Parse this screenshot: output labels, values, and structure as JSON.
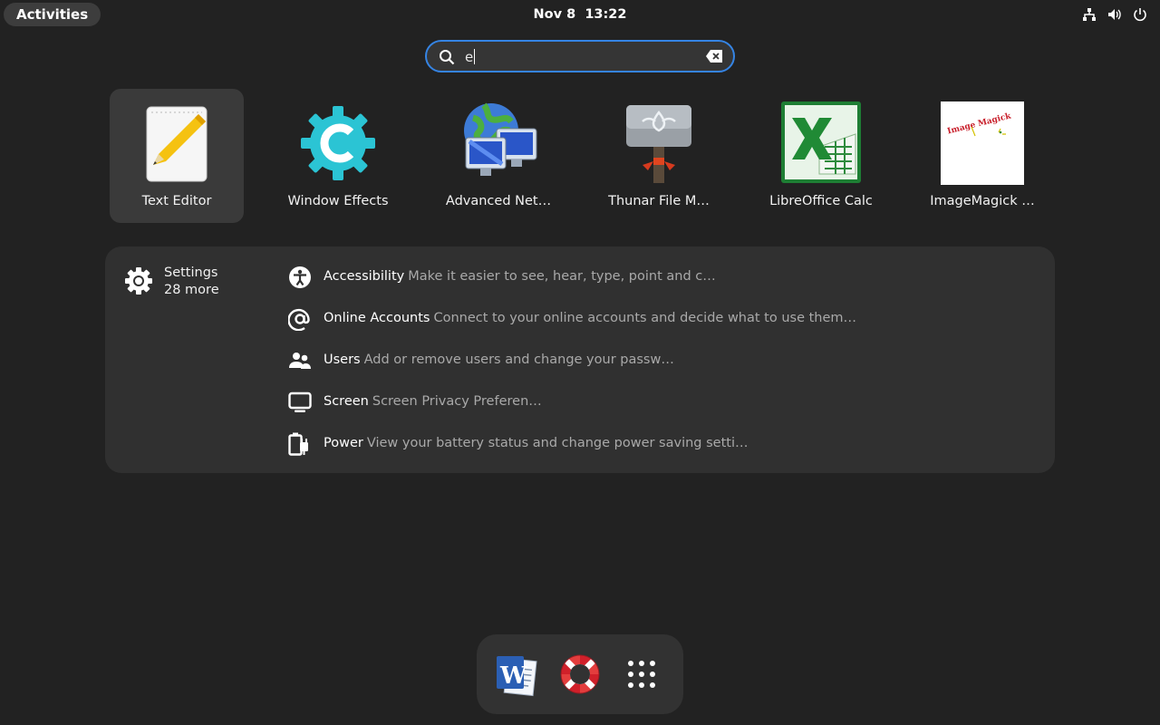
{
  "topbar": {
    "activities_label": "Activities",
    "date": "Nov 8",
    "time": "13:22",
    "tray_icons": [
      "network-icon",
      "volume-icon",
      "power-icon"
    ]
  },
  "search": {
    "query": "e"
  },
  "apps": [
    {
      "label": "Text Editor",
      "icon": "text-editor-icon",
      "selected": true
    },
    {
      "label": "Window Effects",
      "icon": "window-effects-icon"
    },
    {
      "label": "Advanced Net…",
      "icon": "advanced-network-icon"
    },
    {
      "label": "Thunar File M…",
      "icon": "thunar-file-manager-icon"
    },
    {
      "label": "LibreOffice Calc",
      "icon": "libreoffice-calc-icon"
    },
    {
      "label": "ImageMagick …",
      "icon": "imagemagick-icon",
      "icon_text": "Image Magick"
    }
  ],
  "settings_results": {
    "provider": "Settings",
    "more": "28 more",
    "items": [
      {
        "title": "Accessibility",
        "description": "Make it easier to see, hear, type, point and c…",
        "icon": "accessibility-icon"
      },
      {
        "title": "Online Accounts",
        "description": "Connect to your online accounts and decide what to use them…",
        "icon": "at-sign-icon"
      },
      {
        "title": "Users",
        "description": "Add or remove users and change your passw…",
        "icon": "users-icon"
      },
      {
        "title": "Screen",
        "description": "Screen Privacy Preferen…",
        "icon": "monitor-icon"
      },
      {
        "title": "Power",
        "description": "View your battery status and change power saving setti…",
        "icon": "battery-plug-icon"
      }
    ]
  },
  "dash": {
    "items": [
      "word-document-icon",
      "help-lifebuoy-icon",
      "show-apps-grid-icon"
    ]
  },
  "colors": {
    "background": "#222222",
    "accent": "#3584e4",
    "panel": "#303030",
    "dim_text": "#a9a9a9"
  }
}
